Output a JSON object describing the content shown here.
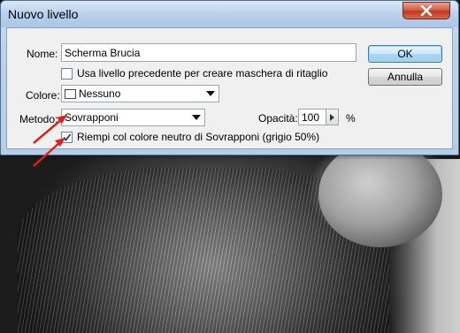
{
  "window": {
    "title": "Nuovo livello"
  },
  "fields": {
    "name_label": "Nome:",
    "name_value": "Scherma Brucia",
    "clipping_mask_label": "Usa livello precedente per creare maschera di ritaglio",
    "color_label": "Colore:",
    "color_value": "Nessuno",
    "mode_label": "Metodo:",
    "mode_value": "Sovrapponi",
    "opacity_label": "Opacità:",
    "opacity_value": "100",
    "opacity_unit": "%",
    "fill_neutral_label": "Riempi col colore neutro di Sovrapponi (grigio 50%)"
  },
  "buttons": {
    "ok": "OK",
    "cancel": "Annulla"
  },
  "state": {
    "clipping_mask_checked": false,
    "fill_neutral_checked": true
  },
  "colors": {
    "annotation_arrow": "#e0201c",
    "close_button": "#c7432b",
    "default_button_border": "#3c7fb1"
  },
  "icons": [
    "close-icon",
    "dropdown-caret-icon",
    "spin-right-icon",
    "checkmark-icon",
    "annotation-arrow"
  ]
}
